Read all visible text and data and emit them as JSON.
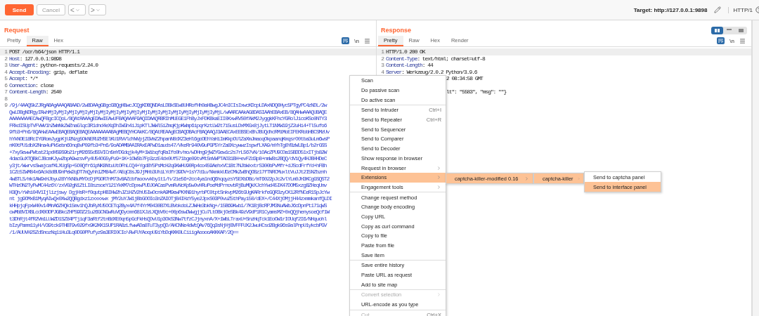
{
  "toolbar": {
    "send": "Send",
    "cancel": "Cancel",
    "back": "<",
    "forward": ">",
    "target": "Target: http://127.0.0.1:9898",
    "protocol": "HTTP/1"
  },
  "request": {
    "title": "Request",
    "wrap_on": true,
    "newline_toggle": "\\n",
    "tabs": [
      {
        "label": "Pretty",
        "selected": false
      },
      {
        "label": "Raw",
        "selected": true
      },
      {
        "label": "Hex",
        "selected": false
      }
    ],
    "lines": [
      {
        "kind": "request-line",
        "num": "1",
        "text": "POST /ocr/b64/json HTTP/1.1"
      },
      {
        "kind": "header",
        "num": "2",
        "key": "Host",
        "value": ": 127.0.0.1:9898"
      },
      {
        "kind": "header",
        "num": "3",
        "key": "User-Agent",
        "value": ": python-requests/2.24.0"
      },
      {
        "kind": "header",
        "num": "4",
        "key": "Accept-Encoding",
        "value": ": gzip, deflate"
      },
      {
        "kind": "header",
        "num": "5",
        "key": "Accept",
        "value": ": */*"
      },
      {
        "kind": "header",
        "num": "6",
        "key": "Connection",
        "value": ": close"
      },
      {
        "kind": "header",
        "num": "7",
        "key": "Content-Length",
        "value": ": 2540"
      },
      {
        "kind": "blank",
        "num": "8"
      },
      {
        "kind": "body",
        "num": "9",
        "rows": [
          "/9j/4AAQSkZJRgABAgAAAQABAAD/2wBDAAgGBgcGBQgHBwcJCQgKDBQNDAsLDBkSEw8UHRofHh0aHBwgJC4nICIsIxwcKDcpLDAxNDQ0Hyc5PTgyPC4zNDL/2w",
          "QwLDBgNDRgyIRwhMjIyMjIyMjIyMjIyMjIyMjIyMjIyMjIyMjIyMjIyMjIyMjIyMjIyMjIyMjIyMjIyMjL/wAARCAAkAG8DASIAAhEBAxEB/8QAHwAAAQUBAQE",
          "AAAAAAAAECAwQFBgcICQoL/8QAtRAAAgEDAwIEAwUFBAQAAAF9AQIDAAQRBRIhMUEGE1FhByJxFDKBkaEII0KxwRVS0fAkM2JyggkKFhcYGRolJicoKSo0NTY3",
          "FRkdISUpTVFVWV1hZWmNkZWZnaGlqc3R1dnd4eXqDhIWGh4iJipKTlJWWl5iZmqKjpKWmp6ipqrKztLW2t7i5usLDxMXGx8jJytLT1NXW19jZ2uHi4+Tl5ufo6",
          "9fb3+Pn6/8QAHwEAAwEBAQEBAQEBAQEAAAAAAAABAgMEBQYHCAkKC/8QAtREAAgECBAQDBAcFBAQAAQJ3AAECAxEEBSExBhJBUQdhcRMiMoEIFEKRobHBCSMzUv",
          "hYkNOE18RcIYGRomJygpKjU2Nzg5OkNERUZHSElKU1RVVldYWVpjZGVmZ2hpanN0dXZ3eHl6goOEhYaHiImKkpOUlZaXmJmaoqOkpaanqKmqsrO0tba3uLm6wsP",
          "nK0tPU1dbX2Nna4uPk5ebn6Onq8vP09fb3+Pn6/9oADAMBAAIRAxEAPwD1auds47/VkeRr940V9uPGP5YrZa8XcywwzIspwfLXA9/mYhTg8YBzWLBp1/b2rGSS",
          "+7xySewwPWtat21pdHS9S9b21rpM26S5d55VICn5mYDGdqjk4yM+1WibqfqRaIfo0h/mo/wDHng9jWZYGew1c2s7rL567vN/iOAcZPU9COa15BDD51xITjb82W",
          "4dacGuXTQBkCJBcmKJyw2bpA9wzsvPy4U54OG5yPu9+1K+1OWSb7Fp3zzE4dx0Uf571bge09tvMt5mVWPTAO31BH+evFZd3p8+nmW8s2BQQ/dViQy4HJBHHDeC",
          "y3jt/WwrvsSwajcafKLXUgSp+5O0Qfr61pNK8NtuUtOFhLCQ4+Ygd8Y5PsMcH2qGKWHU90Rp4co459AehxVC1Bt7NJbWxxtrS300bPvMfr+dJScdFrfYd+hFBh",
          "1CZc5IWM84x6Ack8dBU9nPeW2qDT7mQyhh1ZM84wT/AEqC8sJ9JjMnb3UhiLYdfr39DV+1sY7d1u/NkmkkUDzCMkZwBhQOBz17fTNRCMuxltVuJJt2I5NZbznh",
          "4wBTLS/mk1AW9xHJbyu28YYkN8uMYOcDjPGOR7nM73v8AZcbfaoovvkby1t1/h/2ie56+2cc4ya1ndQ6hqqyzsY5EXbDBc/mT6022pJc2vlYLm0JH3KCgGSQST2",
          "WTHzON2TyPwMC44z6Y/zxV02gN1ZtLI8szsoeY121YkKM7cDpxwPUDJOACasPvmRvNcKp5w0vHRuPoeMdPrnovbRjBuMQkXJchYwd45IK47DOM5xzg8ZHeqUmv",
          "H3Qh/rWhi04V1Ijlizjswy DgjHsR+f0qutpHBIHW2hJZiHZV2hU5IwOcnkA9M9ewPKXN91hyrbPC0tptSnkvpM26tGUgKARrkfeGQR3zyCK12RfNCeR1SpJcYw",
          "nt jg9OMxB1MyqAIwQx0Xw2QQBgdxz1zxxxxwx jMY2uYJW1jBbGOOIo3nZAIOTjB4IHzY5ye2JpxS03P0vuZ5thPayi50/dEX+/C44XjOMjjH44zxmmkanfQLDI",
          "kHHpjqFpxW40v14MnA6ZHQk15mv1hQJbRyXU5OCETq2Byx4A7f4YrM0430B7XLBVokdoLZJWHe3bkNg+/15B69Kwb1/7K1BjBcRPJM3NuAWbJ6cDpnPt171qWS",
          "cwMbBVIXBLcdX0ODPJGBkcZHPS9DZ21u26GCNGwRuVQDycmn681XJzLXQbV0c+00p6swDWwgjjCu7LtOBkjOeSBk49zV9dP1R1CyamsMZ+0xQQjhenysoeQcf1W",
          "t3DhRjt4fR2Vm1LUWZD1SZ84PTjiqF3aRtf2tnBdXE0qn5pGcFkHsQOvU1p3OkS3Nw7tfzCJjnyxnA/X+1WbLTraxU+SnzHqTck1EoOW1rIOUqf2I6/NHquohl",
          "bIzyPamm11yH/V39tck9THBT9v029fx9K2KK15UP1RA8zLfwwADa8TuT3ypQD/AHCNNe4dWtQAv76Qq3sNjHjBVFFFUX2JwuHCsd2Bgk96s9alPnpU1ykcbPGV",
          "/1/AUUVH2SZdSnozNq1iHu3Lq0DG0PPufyz9a3ERI0CIo\\RwFUYAoopU9iYbDqKKK0LCiiigAooooAKKKAP/2Q=="
        ]
      }
    ]
  },
  "response": {
    "title": "Response",
    "wrap_on": true,
    "newline_toggle": "\\n",
    "layout_toggle": [
      {
        "selected": true
      },
      {
        "selected": false
      },
      {
        "selected": false
      }
    ],
    "tabs": [
      {
        "label": "Pretty",
        "selected": true
      },
      {
        "label": "Raw",
        "selected": false
      },
      {
        "label": "Hex",
        "selected": false
      },
      {
        "label": "Render",
        "selected": false
      }
    ],
    "lines": [
      {
        "kind": "request-line",
        "num": "1",
        "text": "HTTP/1.0 200 OK"
      },
      {
        "kind": "header",
        "num": "2",
        "key": "Content-Type",
        "value": ": text/html; charset=utf-8"
      },
      {
        "kind": "header",
        "num": "3",
        "key": "Content-Length",
        "value": ": 44"
      },
      {
        "kind": "header",
        "num": "4",
        "key": "Server",
        "value": ": Werkzeug/2.0.2 Python/3.9.6"
      },
      {
        "kind": "covered",
        "text": "2 08:34:58 GMT"
      },
      {
        "kind": "blank"
      },
      {
        "kind": "covered",
        "text": "lt\": \"5583\", \"msg\": \"\"}"
      }
    ]
  },
  "context_menu": {
    "groups": [
      [
        {
          "label": "Scan"
        },
        {
          "label": "Do passive scan"
        },
        {
          "label": "Do active scan"
        }
      ],
      [
        {
          "label": "Send to Intruder",
          "shortcut": "Ctrl+I"
        },
        {
          "label": "Send to Repeater",
          "shortcut": "Ctrl+R"
        },
        {
          "label": "Send to Sequencer"
        },
        {
          "label": "Send to Comparer"
        },
        {
          "label": "Send to Decoder"
        },
        {
          "label": "Show response in browser"
        },
        {
          "label": "Request in browser",
          "submenu": true
        },
        {
          "label": "Extensions",
          "submenu": true,
          "selected": true
        },
        {
          "label": "Engagement tools",
          "submenu": true
        }
      ],
      [
        {
          "label": "Change request method"
        },
        {
          "label": "Change body encoding"
        },
        {
          "label": "Copy URL"
        },
        {
          "label": "Copy as curl command"
        },
        {
          "label": "Copy to file"
        },
        {
          "label": "Paste from file"
        },
        {
          "label": "Save item"
        }
      ],
      [
        {
          "label": "Save entire history"
        },
        {
          "label": "Paste URL as request"
        },
        {
          "label": "Add to site map"
        }
      ],
      [
        {
          "label": "Convert selection",
          "submenu": true,
          "disabled": true
        },
        {
          "label": "URL-encode as you type"
        }
      ],
      [
        {
          "label": "Cut",
          "shortcut": "Ctrl+X",
          "disabled": true
        }
      ]
    ],
    "submenus": [
      [
        {
          "label": "captcha-killer-modified 0.16",
          "submenu": true,
          "selected": true
        }
      ],
      [
        {
          "label": "captcha-killer",
          "submenu": true,
          "selected": true
        }
      ],
      [
        {
          "label": "Send to captcha panel",
          "selected": false
        },
        {
          "label": "Send to interface panel",
          "selected": true
        }
      ]
    ]
  }
}
